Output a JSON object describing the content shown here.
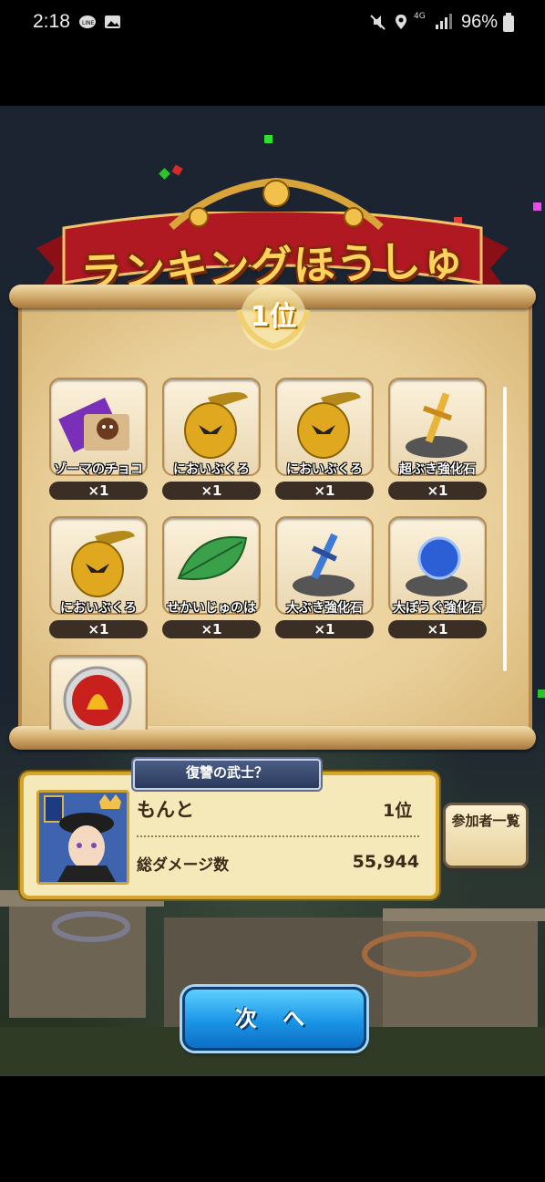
{
  "status_bar": {
    "time": "2:18",
    "battery": "96%",
    "network": "4G"
  },
  "banner": {
    "title": "ランキングほうしゅう",
    "rank_badge": "1位"
  },
  "rewards": [
    {
      "name": "ゾーマのチョコ",
      "qty": "×1",
      "icon": "zoma-chocolate-icon"
    },
    {
      "name": "においぶくろ",
      "qty": "×1",
      "icon": "scent-pouch-icon"
    },
    {
      "name": "においぶくろ",
      "qty": "×1",
      "icon": "scent-pouch-icon"
    },
    {
      "name": "超ぶき強化石",
      "qty": "×1",
      "icon": "super-weapon-stone-icon"
    },
    {
      "name": "においぶくろ",
      "qty": "×1",
      "icon": "scent-pouch-icon"
    },
    {
      "name": "せかいじゅのは",
      "qty": "×1",
      "icon": "world-tree-leaf-icon"
    },
    {
      "name": "大ぶき強化石",
      "qty": "×1",
      "icon": "large-weapon-stone-icon"
    },
    {
      "name": "大ぼうぐ強化石",
      "qty": "×1",
      "icon": "large-armor-stone-icon"
    },
    {
      "name": "",
      "qty": "",
      "icon": "emblem-medal-icon"
    }
  ],
  "player": {
    "title_plate": "復讐の武士？",
    "name": "もんと",
    "rank": "1位",
    "damage_label": "総ダメージ数",
    "damage_value": "55,944"
  },
  "buttons": {
    "participants": "参加者一覧",
    "next": "次 へ"
  },
  "colors": {
    "button_blue": "#1b95e6",
    "panel_gold": "#d4a52b",
    "ribbon_red": "#b01822"
  }
}
